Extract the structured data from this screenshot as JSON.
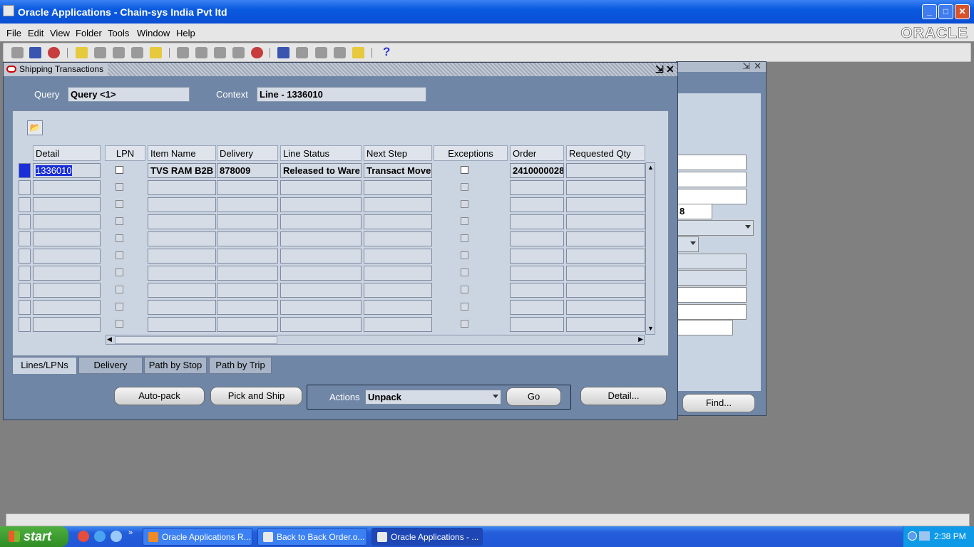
{
  "window": {
    "title": "Oracle Applications - Chain-sys India Pvt ltd",
    "brand": "ORACLE"
  },
  "menu": [
    "File",
    "Edit",
    "View",
    "Folder",
    "Tools",
    "Window",
    "Help"
  ],
  "toolbar": {
    "help_glyph": "?"
  },
  "shipping": {
    "title": "Shipping Transactions",
    "query_label": "Query",
    "query_value": "Query <1>",
    "context_label": "Context",
    "context_value": "Line - 1336010",
    "columns": [
      "Detail",
      "LPN",
      "Item Name",
      "Delivery",
      "Line Status",
      "Next Step",
      "Exceptions",
      "Order",
      "Requested Qty"
    ],
    "rows": [
      {
        "detail": "1336010",
        "item": "TVS RAM B2B",
        "delivery": "878009",
        "status": "Released to Ware",
        "next_step": "Transact Move",
        "order": "2410000028",
        "qty": ""
      }
    ],
    "tabs": [
      "Lines/LPNs",
      "Delivery",
      "Path by Stop",
      "Path by Trip"
    ],
    "buttons": {
      "autopack": "Auto-pack",
      "pickship": "Pick and Ship",
      "go": "Go",
      "detail": "Detail..."
    },
    "actions_label": "Actions",
    "actions_value": "Unpack"
  },
  "background_window": {
    "partial_value": "8",
    "find_button": "Find..."
  },
  "taskbar": {
    "start": "start",
    "tasks": [
      "Oracle Applications R...",
      "Back to Back Order.o...",
      "Oracle Applications - ..."
    ],
    "clock": "2:38 PM"
  }
}
